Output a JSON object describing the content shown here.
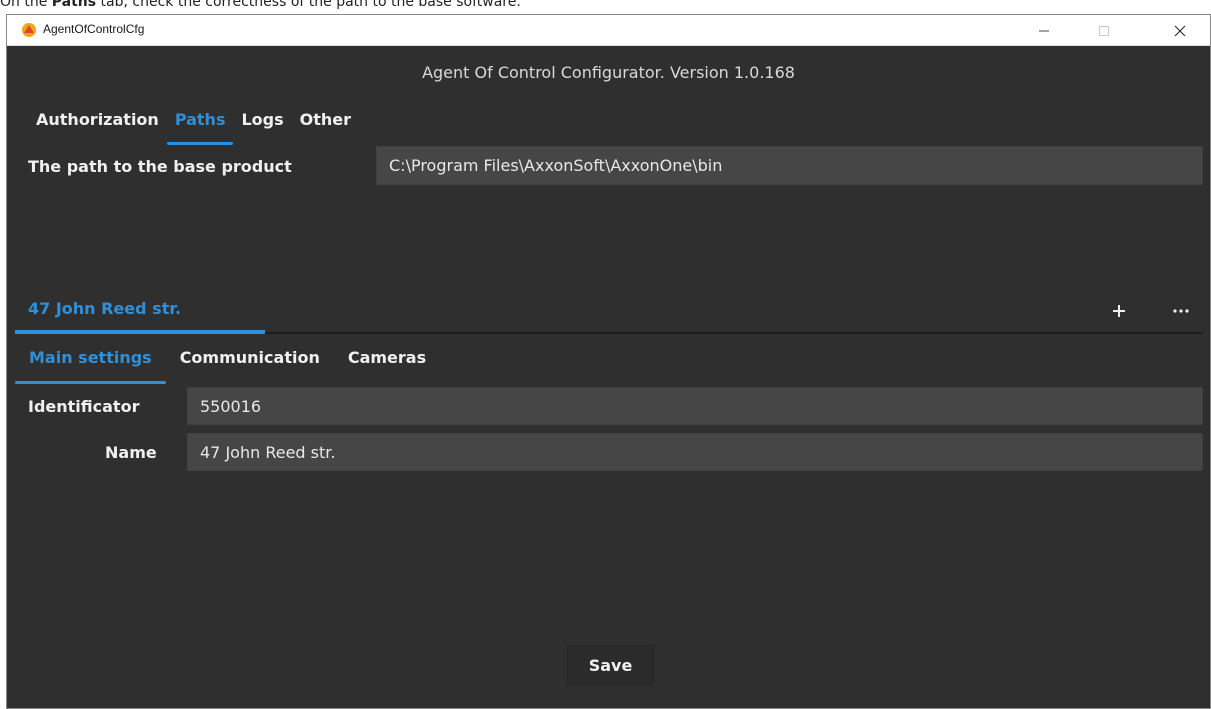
{
  "caption": {
    "prefix": "On the ",
    "bold": "Paths",
    "suffix": " tab, check the correctness of the path to the base software."
  },
  "window": {
    "title": "AgentOfControlCfg",
    "icon": "app-icon"
  },
  "header": {
    "title": "Agent Of Control Configurator. Version 1.0.168"
  },
  "top_tabs": [
    {
      "label": "Authorization",
      "active": false
    },
    {
      "label": "Paths",
      "active": true
    },
    {
      "label": "Logs",
      "active": false
    },
    {
      "label": "Other",
      "active": false
    }
  ],
  "paths": {
    "base_product_label": "The path to the base product",
    "base_product_value": "C:\\Program Files\\AxxonSoft\\AxxonOne\\bin"
  },
  "site": {
    "tab_label": "47 John Reed str.",
    "add_icon": "plus-icon",
    "more_icon": "ellipsis-icon"
  },
  "sub_tabs": [
    {
      "label": "Main settings",
      "active": true
    },
    {
      "label": "Communication",
      "active": false
    },
    {
      "label": "Cameras",
      "active": false
    }
  ],
  "main_settings": {
    "identificator_label": "Identificator",
    "identificator_value": "550016",
    "name_label": "Name",
    "name_value": "47 John Reed str."
  },
  "footer": {
    "save_label": "Save"
  },
  "colors": {
    "background": "#2f2f2f",
    "field": "#464646",
    "accent": "#2f8fd8"
  }
}
